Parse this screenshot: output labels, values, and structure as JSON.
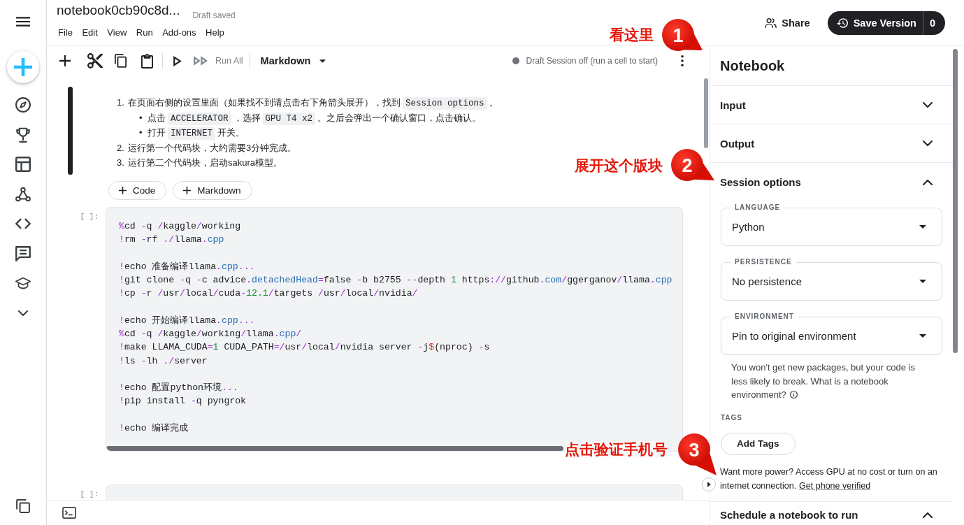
{
  "header": {
    "title": "notebook0cb90c8d...",
    "save_status": "Draft saved",
    "menu": [
      "File",
      "Edit",
      "View",
      "Run",
      "Add-ons",
      "Help"
    ],
    "share": "Share",
    "save_version": "Save Version",
    "version_count": "0"
  },
  "toolbar": {
    "run_all": "Run All",
    "cell_type": "Markdown",
    "session_status": "Draft Session off (run a cell to start)"
  },
  "cells": [
    {
      "kind": "markdown",
      "selected": true,
      "items": [
        {
          "marker": "1.",
          "segments": [
            {
              "text": "在页面右侧的设置里面（如果找不到请点击右下角箭头展开），找到",
              "kind": "text"
            },
            {
              "text": "Session options",
              "kind": "code"
            },
            {
              "text": "。",
              "kind": "text"
            }
          ],
          "children": [
            {
              "marker": "•",
              "segments": [
                {
                  "text": "点击",
                  "kind": "text"
                },
                {
                  "text": "ACCELERATOR",
                  "kind": "code"
                },
                {
                  "text": "，选择",
                  "kind": "text"
                },
                {
                  "text": "GPU T4 x2",
                  "kind": "code"
                },
                {
                  "text": "。之后会弹出一个确认窗口，点击确认。",
                  "kind": "text"
                }
              ]
            },
            {
              "marker": "•",
              "segments": [
                {
                  "text": "打开",
                  "kind": "text"
                },
                {
                  "text": "INTERNET",
                  "kind": "code"
                },
                {
                  "text": "开关。",
                  "kind": "text"
                }
              ]
            }
          ]
        },
        {
          "marker": "2.",
          "segments": [
            {
              "text": "运行第一个代码块，大约需要3分钟完成。",
              "kind": "text"
            }
          ]
        },
        {
          "marker": "3.",
          "segments": [
            {
              "text": "运行第二个代码块，启动sakura模型。",
              "kind": "text"
            }
          ]
        }
      ],
      "add_buttons": [
        "Code",
        "Markdown"
      ]
    },
    {
      "kind": "code",
      "selected": false,
      "prompt": "[ ]:",
      "blocks": [
        [
          [
            {
              "text": "%",
              "kind": "operator"
            },
            {
              "text": "cd ",
              "kind": "plain"
            },
            {
              "text": "-",
              "kind": "operator"
            },
            {
              "text": "q ",
              "kind": "plain"
            },
            {
              "text": "/",
              "kind": "operator"
            },
            {
              "text": "kaggle",
              "kind": "plain"
            },
            {
              "text": "/",
              "kind": "operator"
            },
            {
              "text": "working",
              "kind": "plain"
            }
          ],
          [
            {
              "text": "!",
              "kind": "operator"
            },
            {
              "text": "rm ",
              "kind": "plain"
            },
            {
              "text": "-",
              "kind": "operator"
            },
            {
              "text": "rf ",
              "kind": "plain"
            },
            {
              "text": "./",
              "kind": "operator"
            },
            {
              "text": "llama",
              "kind": "plain"
            },
            {
              "text": ".",
              "kind": "operator"
            },
            {
              "text": "cpp",
              "kind": "property"
            }
          ]
        ],
        [
          [
            {
              "text": "!",
              "kind": "operator"
            },
            {
              "text": "echo 准备编译llama",
              "kind": "plain"
            },
            {
              "text": ".",
              "kind": "operator"
            },
            {
              "text": "cpp",
              "kind": "property"
            },
            {
              "text": "...",
              "kind": "operator"
            }
          ],
          [
            {
              "text": "!",
              "kind": "operator"
            },
            {
              "text": "git clone ",
              "kind": "plain"
            },
            {
              "text": "-",
              "kind": "operator"
            },
            {
              "text": "q ",
              "kind": "plain"
            },
            {
              "text": "-",
              "kind": "operator"
            },
            {
              "text": "c advice",
              "kind": "plain"
            },
            {
              "text": ".",
              "kind": "operator"
            },
            {
              "text": "detachedHead",
              "kind": "property"
            },
            {
              "text": "=",
              "kind": "operator"
            },
            {
              "text": "false ",
              "kind": "plain"
            },
            {
              "text": "-",
              "kind": "operator"
            },
            {
              "text": "b b2755 ",
              "kind": "plain"
            },
            {
              "text": "--",
              "kind": "operator"
            },
            {
              "text": "depth ",
              "kind": "plain"
            },
            {
              "text": "1",
              "kind": "number"
            },
            {
              "text": " https",
              "kind": "plain"
            },
            {
              "text": "://",
              "kind": "operator"
            },
            {
              "text": "github",
              "kind": "plain"
            },
            {
              "text": ".",
              "kind": "operator"
            },
            {
              "text": "com",
              "kind": "property"
            },
            {
              "text": "/",
              "kind": "operator"
            },
            {
              "text": "ggerganov",
              "kind": "plain"
            },
            {
              "text": "/",
              "kind": "operator"
            },
            {
              "text": "llama",
              "kind": "plain"
            },
            {
              "text": ".",
              "kind": "operator"
            },
            {
              "text": "cpp",
              "kind": "property"
            }
          ],
          [
            {
              "text": "!",
              "kind": "operator"
            },
            {
              "text": "cp ",
              "kind": "plain"
            },
            {
              "text": "-",
              "kind": "operator"
            },
            {
              "text": "r ",
              "kind": "plain"
            },
            {
              "text": "/",
              "kind": "operator"
            },
            {
              "text": "usr",
              "kind": "plain"
            },
            {
              "text": "/",
              "kind": "operator"
            },
            {
              "text": "local",
              "kind": "plain"
            },
            {
              "text": "/",
              "kind": "operator"
            },
            {
              "text": "cuda",
              "kind": "plain"
            },
            {
              "text": "-",
              "kind": "operator"
            },
            {
              "text": "12.1",
              "kind": "number"
            },
            {
              "text": "/",
              "kind": "operator"
            },
            {
              "text": "targets ",
              "kind": "plain"
            },
            {
              "text": "/",
              "kind": "operator"
            },
            {
              "text": "usr",
              "kind": "plain"
            },
            {
              "text": "/",
              "kind": "operator"
            },
            {
              "text": "local",
              "kind": "plain"
            },
            {
              "text": "/",
              "kind": "operator"
            },
            {
              "text": "nvidia",
              "kind": "plain"
            },
            {
              "text": "/",
              "kind": "operator"
            }
          ]
        ],
        [
          [
            {
              "text": "!",
              "kind": "operator"
            },
            {
              "text": "echo 开始编译llama",
              "kind": "plain"
            },
            {
              "text": ".",
              "kind": "operator"
            },
            {
              "text": "cpp",
              "kind": "property"
            },
            {
              "text": "...",
              "kind": "operator"
            }
          ],
          [
            {
              "text": "%",
              "kind": "operator"
            },
            {
              "text": "cd ",
              "kind": "plain"
            },
            {
              "text": "-",
              "kind": "operator"
            },
            {
              "text": "q ",
              "kind": "plain"
            },
            {
              "text": "/",
              "kind": "operator"
            },
            {
              "text": "kaggle",
              "kind": "plain"
            },
            {
              "text": "/",
              "kind": "operator"
            },
            {
              "text": "working",
              "kind": "plain"
            },
            {
              "text": "/",
              "kind": "operator"
            },
            {
              "text": "llama",
              "kind": "plain"
            },
            {
              "text": ".",
              "kind": "operator"
            },
            {
              "text": "cpp",
              "kind": "property"
            },
            {
              "text": "/",
              "kind": "operator"
            }
          ],
          [
            {
              "text": "!",
              "kind": "operator"
            },
            {
              "text": "make LLAMA_CUDA",
              "kind": "plain"
            },
            {
              "text": "=",
              "kind": "operator"
            },
            {
              "text": "1",
              "kind": "number"
            },
            {
              "text": " CUDA_PATH",
              "kind": "plain"
            },
            {
              "text": "=/",
              "kind": "operator"
            },
            {
              "text": "usr",
              "kind": "plain"
            },
            {
              "text": "/",
              "kind": "operator"
            },
            {
              "text": "local",
              "kind": "plain"
            },
            {
              "text": "/",
              "kind": "operator"
            },
            {
              "text": "nvidia server ",
              "kind": "plain"
            },
            {
              "text": "-",
              "kind": "operator"
            },
            {
              "text": "j",
              "kind": "plain"
            },
            {
              "text": "$",
              "kind": "variable"
            },
            {
              "text": "(nproc) ",
              "kind": "plain"
            },
            {
              "text": "-",
              "kind": "operator"
            },
            {
              "text": "s",
              "kind": "plain"
            }
          ],
          [
            {
              "text": "!",
              "kind": "operator"
            },
            {
              "text": "ls ",
              "kind": "plain"
            },
            {
              "text": "-",
              "kind": "operator"
            },
            {
              "text": "lh ",
              "kind": "plain"
            },
            {
              "text": "./",
              "kind": "operator"
            },
            {
              "text": "server",
              "kind": "plain"
            }
          ]
        ],
        [
          [
            {
              "text": "!",
              "kind": "operator"
            },
            {
              "text": "echo 配置python环境",
              "kind": "plain"
            },
            {
              "text": "...",
              "kind": "operator"
            }
          ],
          [
            {
              "text": "!",
              "kind": "operator"
            },
            {
              "text": "pip install ",
              "kind": "plain"
            },
            {
              "text": "-",
              "kind": "operator"
            },
            {
              "text": "q pyngrok",
              "kind": "plain"
            }
          ]
        ],
        [
          [
            {
              "text": "!",
              "kind": "operator"
            },
            {
              "text": "echo 编译完成",
              "kind": "plain"
            }
          ]
        ]
      ]
    },
    {
      "kind": "code",
      "selected": false,
      "prompt": "[ ]:"
    }
  ],
  "panel": {
    "title": "Notebook",
    "sections": [
      {
        "label": "Input",
        "expanded": false
      },
      {
        "label": "Output",
        "expanded": false
      },
      {
        "label": "Session options",
        "expanded": true,
        "fields": [
          {
            "label": "LANGUAGE",
            "value": "Python"
          },
          {
            "label": "PERSISTENCE",
            "value": "No persistence"
          },
          {
            "label": "ENVIRONMENT",
            "value": "Pin to original environment"
          }
        ],
        "environment_help": "You won't get new packages, but your code is less likely to break. What is a notebook environment?",
        "tags_label": "TAGS",
        "add_tags": "Add Tags",
        "power_note": "Want more power? Access GPU at no cost or turn on an internet connection.",
        "power_link": "Get phone verified"
      },
      {
        "label": "Schedule a notebook to run",
        "expanded": true
      }
    ]
  },
  "annotations": [
    {
      "number": "1",
      "label": "看这里"
    },
    {
      "number": "2",
      "label": "展开这个版块"
    },
    {
      "number": "3",
      "label": "点击验证手机号"
    }
  ]
}
